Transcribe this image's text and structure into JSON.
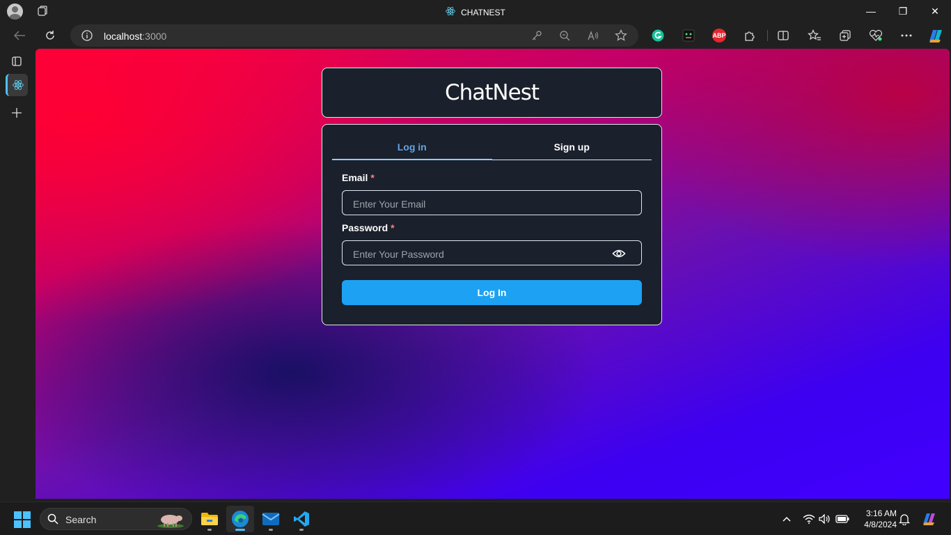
{
  "window": {
    "title": "CHATNEST",
    "minimize": "—",
    "restore": "❐",
    "close": "✕"
  },
  "address_bar": {
    "host": "localhost",
    "port": ":3000"
  },
  "extensions": {
    "abp_label": "ABP"
  },
  "app": {
    "brand": "ChatNest",
    "tabs": [
      {
        "label": "Log in",
        "active": true
      },
      {
        "label": "Sign up",
        "active": false
      }
    ],
    "email": {
      "label": "Email",
      "required_mark": "*",
      "placeholder": "Enter Your Email"
    },
    "password": {
      "label": "Password",
      "required_mark": "*",
      "placeholder": "Enter Your Password"
    },
    "submit_label": "Log In"
  },
  "taskbar": {
    "search_label": "Search",
    "time": "3:16 AM",
    "date": "4/8/2024"
  },
  "colors": {
    "accent": "#1da1f2",
    "active_tab": "#63a4e6",
    "card": "#1a202c",
    "required": "#fc8181"
  }
}
